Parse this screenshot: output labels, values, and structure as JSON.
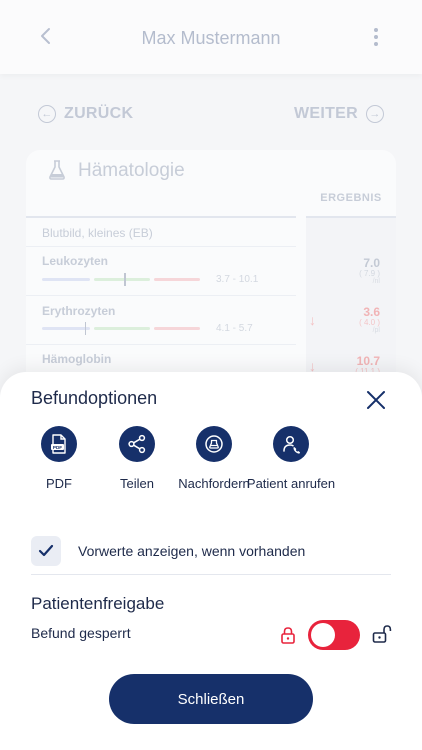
{
  "header": {
    "title": "Max Mustermann"
  },
  "nav": {
    "back_label": "ZURÜCK",
    "next_label": "WEITER"
  },
  "card": {
    "title": "Hämatologie",
    "column_header": "ERGEBNIS",
    "group": "Blutbild, kleines (EB)",
    "rows": [
      {
        "name": "Leukozyten",
        "range": "3.7 - 10.1",
        "value": "7.0",
        "previous": "( 7.9 )",
        "unit": "/nl",
        "flag": "normal",
        "marker": 0.52
      },
      {
        "name": "Erythrozyten",
        "range": "4.1 - 5.7",
        "value": "3.6",
        "previous": "( 4.0 )",
        "unit": "/pl",
        "flag": "low",
        "marker": 0.27
      },
      {
        "name": "Hämoglobin",
        "range": "",
        "value": "10.7",
        "previous": "( 11.1 )",
        "unit": "",
        "flag": "low",
        "marker": null
      }
    ]
  },
  "sheet": {
    "title": "Befundoptionen",
    "options": [
      {
        "label": "PDF",
        "icon": "pdf-icon"
      },
      {
        "label": "Teilen",
        "icon": "share-icon"
      },
      {
        "label": "Nachfordern",
        "icon": "request-icon"
      },
      {
        "label": "Patient anrufen",
        "icon": "phone-icon"
      }
    ],
    "previous_values": {
      "label": "Vorwerte anzeigen, wenn vorhanden",
      "checked": true
    },
    "release": {
      "title": "Patientenfreigabe",
      "label": "Befund gesperrt",
      "locked": true
    },
    "close_label": "Schließen"
  },
  "colors": {
    "primary": "#16306a",
    "toggle_on": "#e8233c",
    "text": "#1e2a4a"
  }
}
